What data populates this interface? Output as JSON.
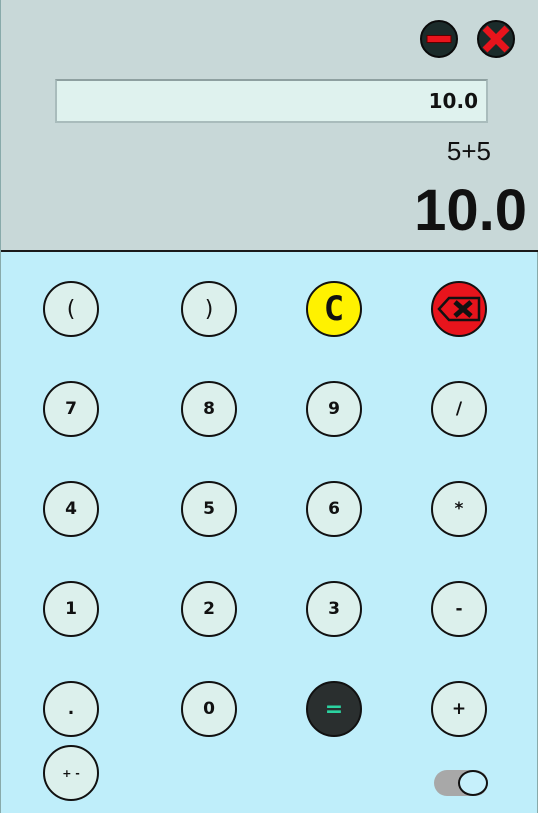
{
  "display": {
    "entry_value": "10.0",
    "expression": "5+5",
    "result": "10.0"
  },
  "window_controls": {
    "minimize_icon": "minus-icon",
    "close_icon": "x-icon",
    "colors": {
      "minimize": "#e8141c",
      "close": "#e8141c"
    }
  },
  "keys": {
    "open_paren": "(",
    "close_paren": ")",
    "clear": "C",
    "backspace_icon": "backspace-x-icon",
    "seven": "7",
    "eight": "8",
    "nine": "9",
    "divide": "/",
    "four": "4",
    "five": "5",
    "six": "6",
    "multiply": "*",
    "one": "1",
    "two": "2",
    "three": "3",
    "subtract": "-",
    "decimal": ".",
    "zero": "0",
    "equals": "=",
    "add": "+",
    "plus_minus": "+ -"
  },
  "toggle": {
    "state": "on",
    "icon": "theme-toggle-switch"
  },
  "colors": {
    "keypad_background": "#bfeefa",
    "display_background": "#c8d8d8",
    "clear_button": "#fff200",
    "backspace_button": "#e8141c",
    "equals_button": "#2a2f2f",
    "equals_text": "#2bd3a0"
  }
}
